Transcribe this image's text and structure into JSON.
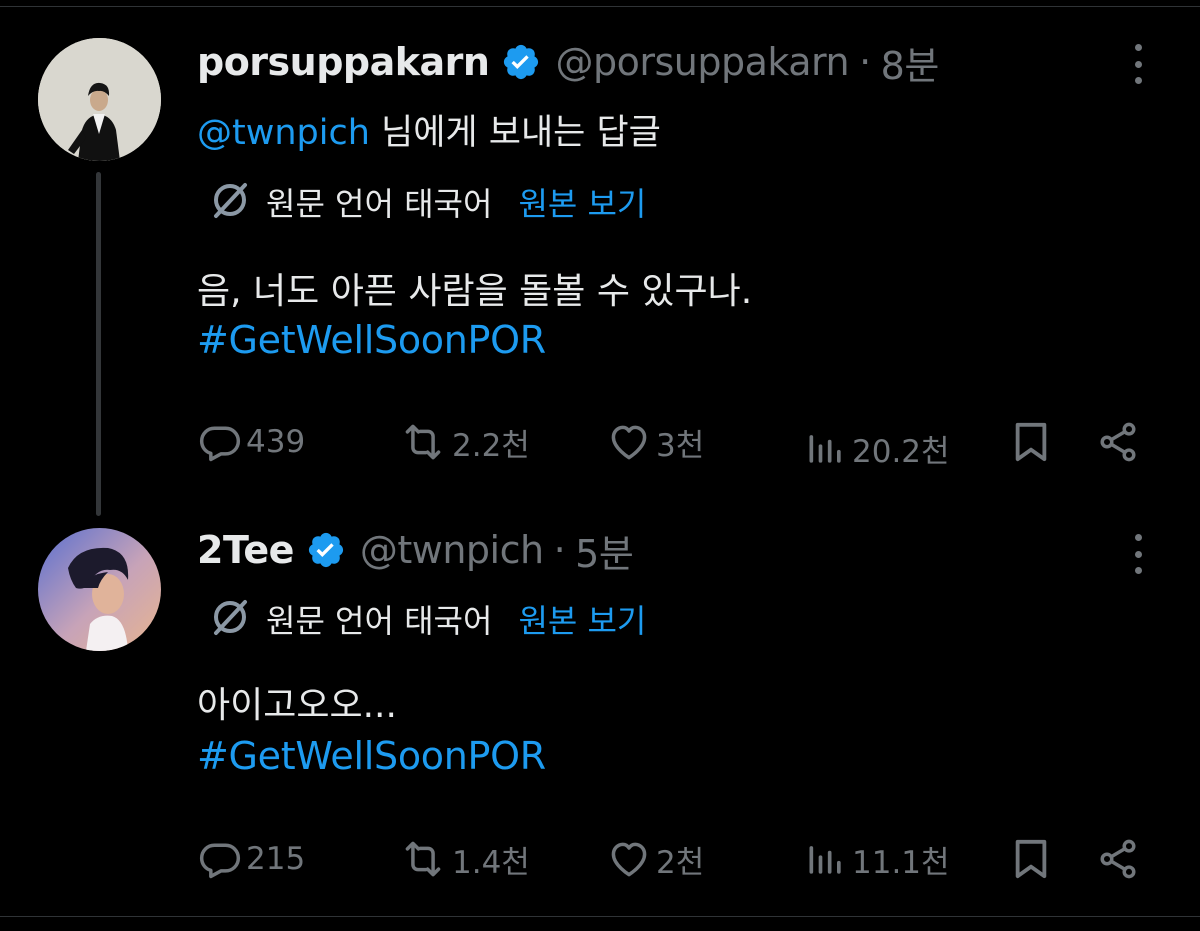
{
  "thread": [
    {
      "display_name": "porsuppakarn",
      "handle": "@porsuppakarn",
      "separator": "·",
      "time": "8분",
      "reply_mention": "@twnpich",
      "reply_suffix": " 님에게 보내는 답글",
      "translation_label": "원문 언어 태국어",
      "show_original_label": "원본 보기",
      "text": "음, 너도 아픈 사람을 돌볼 수 있구나.",
      "hashtag": "#GetWellSoonPOR",
      "replies": "439",
      "reposts": "2.2천",
      "likes": "3천",
      "views": "20.2천"
    },
    {
      "display_name": "2Tee",
      "handle": "@twnpich",
      "separator": "·",
      "time": "5분",
      "translation_label": "원문 언어 태국어",
      "show_original_label": "원본 보기",
      "text": "아이고오오...",
      "hashtag": "#GetWellSoonPOR",
      "replies": "215",
      "reposts": "1.4천",
      "likes": "2천",
      "views": "11.1천"
    }
  ],
  "icons": {
    "verified": "verified-badge-icon",
    "translate": "translate-icon",
    "reply": "reply-icon",
    "repost": "repost-icon",
    "like": "heart-icon",
    "views": "views-icon",
    "bookmark": "bookmark-icon",
    "share": "share-icon",
    "more": "more-icon"
  },
  "colors": {
    "background": "#000000",
    "text": "#e7e9ea",
    "muted": "#71767b",
    "accent": "#1d9bf0"
  }
}
